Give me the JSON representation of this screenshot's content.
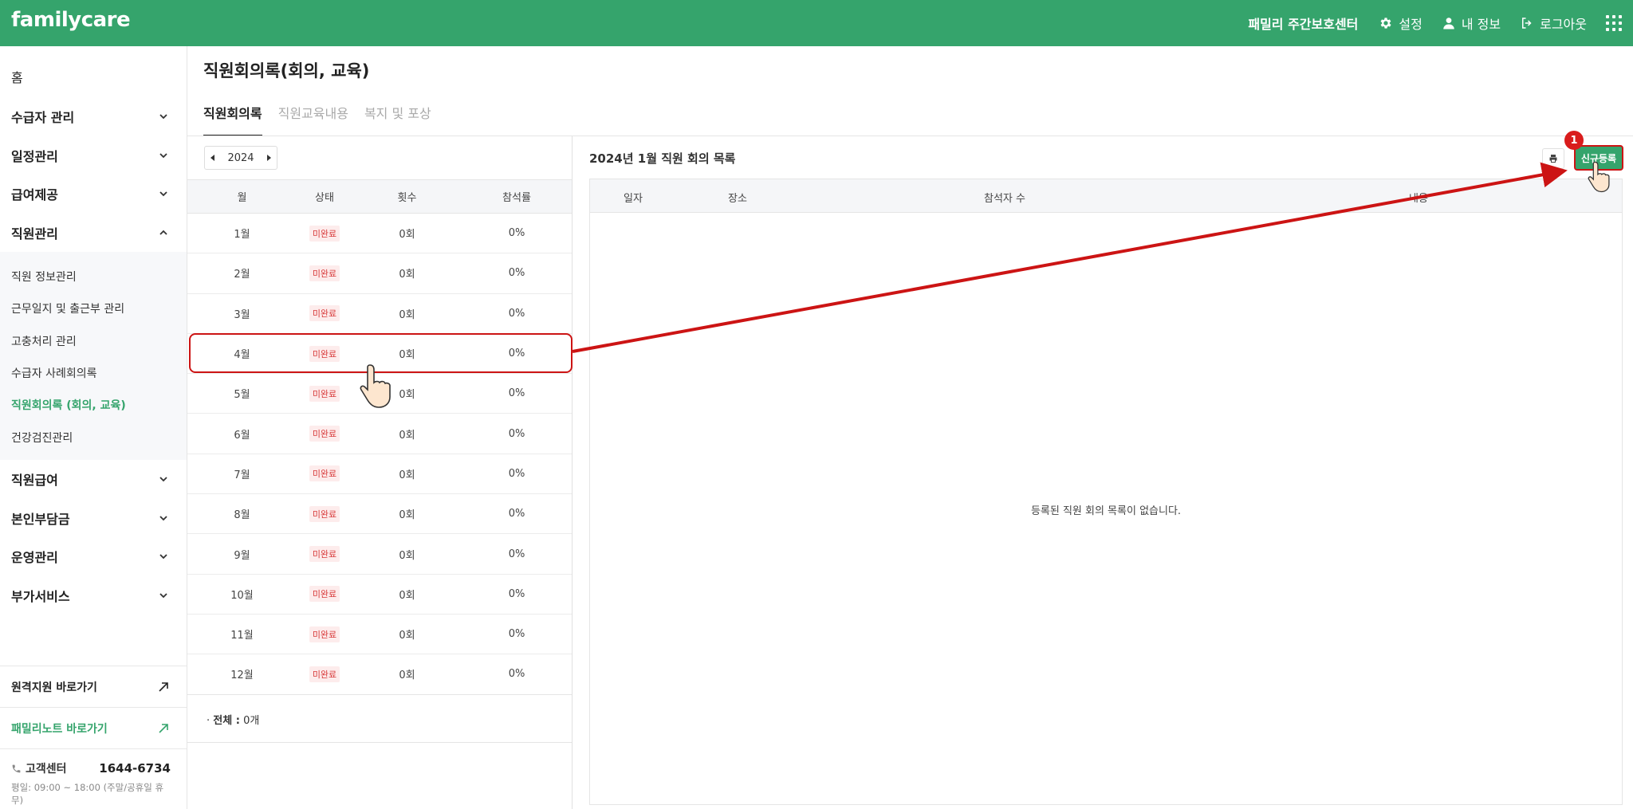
{
  "header": {
    "logo": "familycare",
    "center_name": "패밀리 주간보호센터",
    "settings_label": "설정",
    "my_info_label": "내 정보",
    "logout_label": "로그아웃"
  },
  "sidebar": {
    "home": "홈",
    "items": [
      {
        "label": "수급자 관리"
      },
      {
        "label": "일정관리"
      },
      {
        "label": "급여제공"
      },
      {
        "label": "직원관리"
      }
    ],
    "submenu": [
      {
        "label": "직원 정보관리"
      },
      {
        "label": "근무일지 및 출근부 관리"
      },
      {
        "label": "고충처리 관리"
      },
      {
        "label": "수급자 사례회의록"
      },
      {
        "label": "직원회의록 (회의, 교육)"
      },
      {
        "label": "건강검진관리"
      }
    ],
    "items_after": [
      {
        "label": "직원급여"
      },
      {
        "label": "본인부담금"
      },
      {
        "label": "운영관리"
      },
      {
        "label": "부가서비스"
      }
    ],
    "remote_link": "원격지원 바로가기",
    "note_link": "패밀리노트 바로가기",
    "support_label": "고객센터",
    "support_phone": "1644-6734",
    "support_hours": "평일: 09:00 ~ 18:00 (주말/공휴일 휴무)"
  },
  "page": {
    "title": "직원회의록(회의, 교육)",
    "tabs": [
      "직원회의록",
      "직원교육내용",
      "복지 및 포상"
    ]
  },
  "left_panel": {
    "year": "2024",
    "columns": [
      "월",
      "상태",
      "횟수",
      "참석률"
    ],
    "rows": [
      {
        "month": "1월",
        "status": "미완료",
        "count": "0회",
        "rate": "0%"
      },
      {
        "month": "2월",
        "status": "미완료",
        "count": "0회",
        "rate": "0%"
      },
      {
        "month": "3월",
        "status": "미완료",
        "count": "0회",
        "rate": "0%"
      },
      {
        "month": "4월",
        "status": "미완료",
        "count": "0회",
        "rate": "0%"
      },
      {
        "month": "5월",
        "status": "미완료",
        "count": "0회",
        "rate": "0%"
      },
      {
        "month": "6월",
        "status": "미완료",
        "count": "0회",
        "rate": "0%"
      },
      {
        "month": "7월",
        "status": "미완료",
        "count": "0회",
        "rate": "0%"
      },
      {
        "month": "8월",
        "status": "미완료",
        "count": "0회",
        "rate": "0%"
      },
      {
        "month": "9월",
        "status": "미완료",
        "count": "0회",
        "rate": "0%"
      },
      {
        "month": "10월",
        "status": "미완료",
        "count": "0회",
        "rate": "0%"
      },
      {
        "month": "11월",
        "status": "미완료",
        "count": "0회",
        "rate": "0%"
      },
      {
        "month": "12월",
        "status": "미완료",
        "count": "0회",
        "rate": "0%"
      }
    ],
    "total_label": "전체 :",
    "total_value": "0개"
  },
  "right_panel": {
    "title": "2024년 1월 직원 회의 목록",
    "new_button": "신규등록",
    "marker": "1",
    "columns": [
      "일자",
      "장소",
      "참석자 수",
      "내용"
    ],
    "empty_message": "등록된 직원 회의 목록이 없습니다."
  },
  "colors": {
    "brand": "#35a46c",
    "annotation": "#cc1414",
    "badge_text": "#d83a3a",
    "badge_bg": "#fdecec"
  }
}
